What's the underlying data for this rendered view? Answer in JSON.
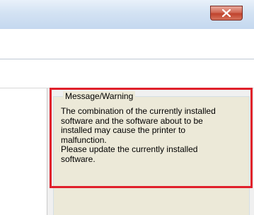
{
  "window": {
    "close_icon": "close-icon"
  },
  "message_panel": {
    "title": "Message/Warning",
    "text": "The combination of the currently installed\nsoftware and the software about to be\ninstalled may cause the printer to\nmalfunction.\nPlease update the currently installed\nsoftware."
  },
  "colors": {
    "highlight": "#e0202b",
    "close_button": "#c0432d",
    "titlebar": "#c4d8ef"
  }
}
